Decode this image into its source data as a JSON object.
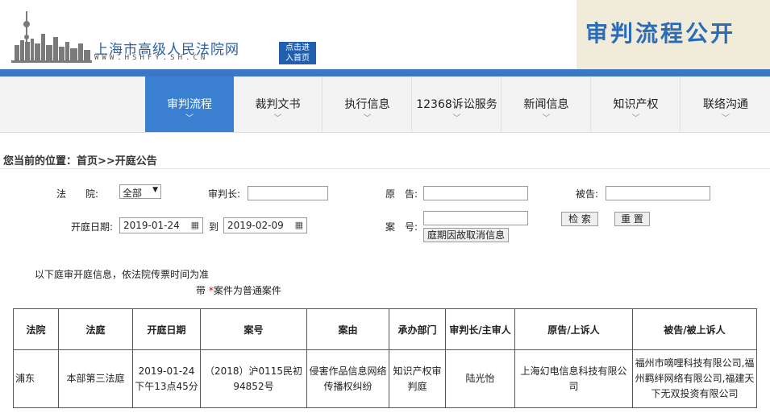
{
  "header": {
    "site_name": "上海市高级人民法院网",
    "site_url": "WWW.HSHFY.SH.CN",
    "home_button_line1": "点击进",
    "home_button_line2": "入首页",
    "banner_title": "审判流程公开"
  },
  "nav": {
    "items": [
      {
        "label": "审判流程",
        "active": true
      },
      {
        "label": "裁判文书"
      },
      {
        "label": "执行信息"
      },
      {
        "label": "12368诉讼服务"
      },
      {
        "label": "新闻信息"
      },
      {
        "label": "知识产权"
      },
      {
        "label": "联络沟通"
      }
    ]
  },
  "breadcrumb": "您当前的位置：首页>>开庭公告",
  "form": {
    "court_label": "法　　院:",
    "court_value": "全部",
    "judge_label": "审判长:",
    "plaintiff_label": "原　告:",
    "defendant_label": "被告:",
    "date_label": "开庭日期:",
    "date_from": "2019-01-24",
    "date_to_label": "到",
    "date_to": "2019-02-09",
    "case_no_label": "案　号:",
    "search_button": "检 索",
    "reset_button": "重 置",
    "cancel_info_button": "庭期因故取消信息"
  },
  "notes": {
    "line1": "以下庭审开庭信息，依法院传票时间为准",
    "line2_prefix": "带 ",
    "line2_star": "*",
    "line2_suffix": "案件为普通案件"
  },
  "table": {
    "headers": [
      "法院",
      "法庭",
      "开庭日期",
      "案号",
      "案由",
      "承办部门",
      "审判长/主审人",
      "原告/上诉人",
      "被告/被上诉人"
    ],
    "rows": [
      [
        "浦东",
        "本部第三法庭",
        "2019-01-24下午13点45分",
        "（2018）沪0115民初94852号",
        "侵害作品信息网络传播权纠纷",
        "知识产权审判庭",
        "陆光怡",
        "上海幻电信息科技有限公司",
        "福州市嘀哩科技有限公司,福州羁绊网络有限公司,福建天下无双投资有限公司"
      ]
    ]
  }
}
